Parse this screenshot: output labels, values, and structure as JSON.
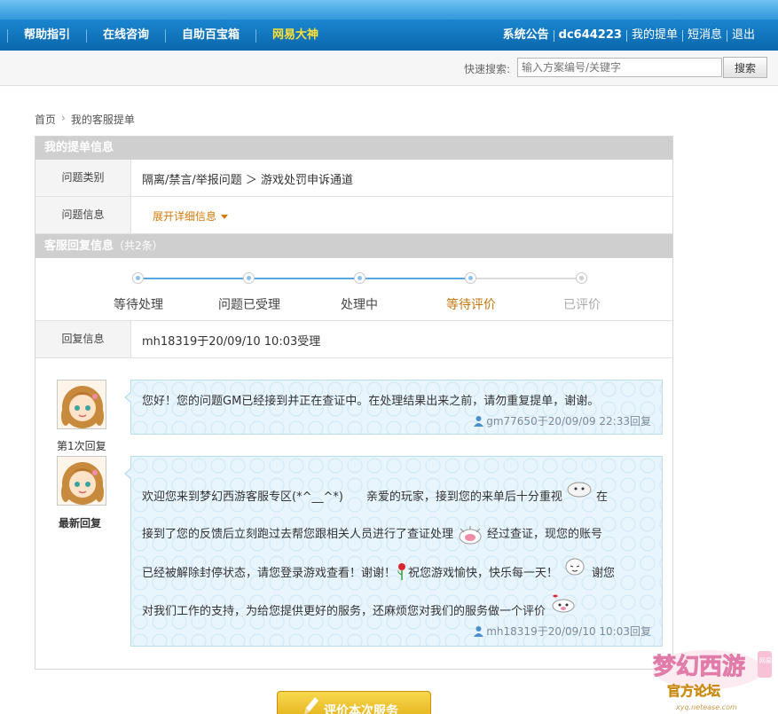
{
  "nav": {
    "items": [
      "帮助指引",
      "在线咨询",
      "自助百宝箱",
      "网易大神"
    ],
    "right": [
      "系统公告",
      "dc644223",
      "我的提单",
      "短消息",
      "退出"
    ]
  },
  "search": {
    "label": "快速搜索:",
    "placeholder": "输入方案编号/关键字",
    "button": "搜索"
  },
  "breadcrumb": {
    "home": "首页",
    "current": "我的客服提单"
  },
  "ticket": {
    "section_title": "我的提单信息",
    "category_label": "问题类别",
    "category_value": "隔离/禁言/举报问题 ＞ 游戏处罚申诉通道",
    "info_label": "问题信息",
    "expand_text": "展开详细信息"
  },
  "reply_section": {
    "title": "客服回复信息",
    "count": "（共2条）",
    "steps": [
      "等待处理",
      "问题已受理",
      "处理中",
      "等待评价",
      "已评价"
    ],
    "current_step": "等待评价",
    "reply_info_label": "回复信息",
    "reply_info_value": "mh18319于20/09/10 10:03受理"
  },
  "replies": [
    {
      "caption": "第1次回复",
      "text": "您好！您的问题GM已经接到并正在查证中。在处理结果出来之前，请勿重复提单，谢谢。",
      "signature": "gm77650于20/09/09 22:33回复"
    },
    {
      "caption": "最新回复",
      "lines": [
        [
          "欢迎您来到梦幻西游客服专区(*^__^*)　　亲爱的玩家，接到您的来单后十分重视",
          "在"
        ],
        [
          "接到了您的反馈后立刻跑过去帮您跟相关人员进行了查证处理",
          "经过查证，现您的账号"
        ],
        [
          "已经被解除封停状态，请您登录游戏查看！谢谢！",
          "祝您游戏愉快，快乐每一天！",
          "谢您"
        ],
        [
          "对我们工作的支持，为给您提供更好的服务，还麻烦您对我们的服务做一个评价"
        ]
      ],
      "signature": "mh18319于20/09/10 10:03回复"
    }
  ],
  "evaluate_button": "评价本次服务",
  "logo": {
    "title": "梦幻西游",
    "subtitle": "官方论坛",
    "url": "xyq.netease.com",
    "badge": "网易"
  },
  "icons": {
    "user": "user-icon",
    "pencil": "pencil-icon",
    "rose": "rose-icon",
    "chevron": "chevron-right-icon"
  },
  "colors": {
    "nav_bg": "#0d6fb8",
    "nav_highlight": "#ffe033",
    "accent_orange": "#c4760e",
    "progress_blue": "#5aa8df",
    "bubble_bg": "#e9f5fc",
    "section_head": "#cfcfcf",
    "button_gold": "#e2a90f"
  }
}
